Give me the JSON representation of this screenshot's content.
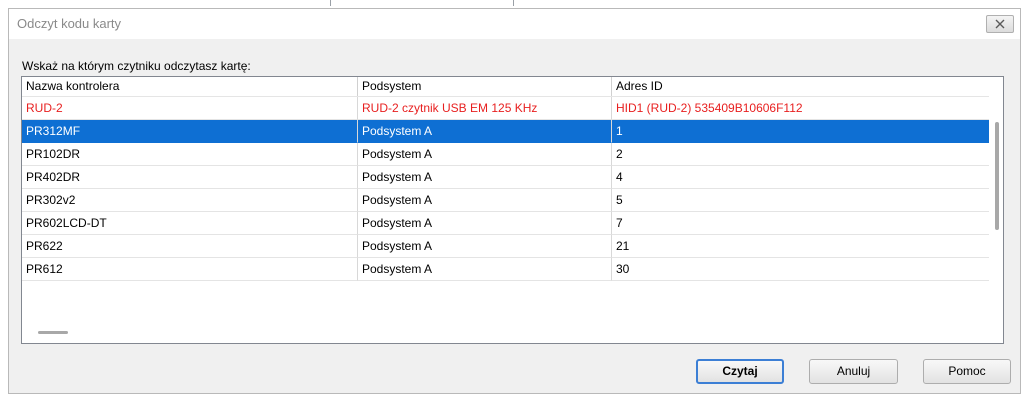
{
  "dialog": {
    "title": "Odczyt kodu karty",
    "prompt": "Wskaż na którym czytniku odczytasz kartę:"
  },
  "table": {
    "columns": [
      "Nazwa kontrolera",
      "Podsystem",
      "Adres ID"
    ],
    "rows": [
      [
        "RUD-2",
        "RUD-2 czytnik USB EM 125 KHz",
        "HID1 (RUD-2) 535409B10606F112"
      ],
      [
        "PR312MF",
        "Podsystem A",
        "1"
      ],
      [
        "PR102DR",
        "Podsystem A",
        "2"
      ],
      [
        "PR402DR",
        "Podsystem A",
        "4"
      ],
      [
        "PR302v2",
        "Podsystem A",
        "5"
      ],
      [
        "PR602LCD-DT",
        "Podsystem A",
        "7"
      ],
      [
        "PR622",
        "Podsystem A",
        "21"
      ],
      [
        "PR612",
        "Podsystem A",
        "30"
      ]
    ],
    "highlight_row": 0,
    "selected_row": 1
  },
  "buttons": {
    "read": "Czytaj",
    "cancel": "Anuluj",
    "help": "Pomoc"
  },
  "colors": {
    "selection": "#0e6fd3",
    "highlight_text": "#e81f1f",
    "default_button_border": "#3c7fd5"
  }
}
